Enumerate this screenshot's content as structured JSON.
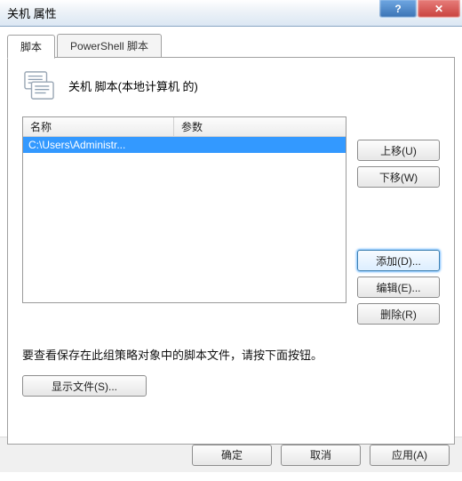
{
  "window": {
    "title": "关机 属性",
    "help_glyph": "?",
    "close_glyph": "✕"
  },
  "tabs": {
    "active": "脚本",
    "inactive": "PowerShell 脚本"
  },
  "header": {
    "text": "关机 脚本(本地计算机 的)"
  },
  "list": {
    "columns": {
      "name": "名称",
      "param": "参数"
    },
    "rows": [
      {
        "name": "C:\\Users\\Administr...",
        "param": ""
      }
    ]
  },
  "sidebuttons": {
    "move_up": "上移(U)",
    "move_down": "下移(W)",
    "add": "添加(D)...",
    "edit": "编辑(E)...",
    "remove": "删除(R)"
  },
  "hint": "要查看保存在此组策略对象中的脚本文件，请按下面按钮。",
  "show_files": "显示文件(S)...",
  "footer": {
    "ok": "确定",
    "cancel": "取消",
    "apply": "应用(A)"
  }
}
